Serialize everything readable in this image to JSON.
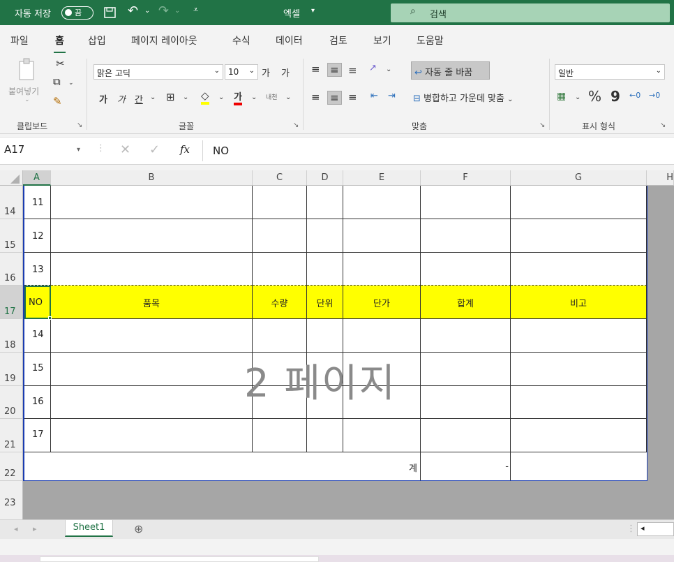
{
  "titlebar": {
    "autosave_label": "자동 저장",
    "autosave_state": "끔",
    "app_title": "엑셀",
    "search_placeholder": "검색"
  },
  "menu": {
    "tabs": [
      {
        "label": "파일"
      },
      {
        "label": "홈",
        "active": true
      },
      {
        "label": "삽입"
      },
      {
        "label": "페이지 레이아웃"
      },
      {
        "label": "수식"
      },
      {
        "label": "데이터"
      },
      {
        "label": "검토"
      },
      {
        "label": "보기"
      },
      {
        "label": "도움말"
      }
    ]
  },
  "ribbon": {
    "clipboard": {
      "paste_label": "붙여넣기",
      "group_label": "클립보드"
    },
    "font": {
      "font_name": "맑은 고딕",
      "font_size": "10",
      "grow": "가",
      "shrink": "가",
      "bold": "가",
      "italic": "가",
      "underline": "간",
      "font_color_glyph": "가",
      "phonetic": "내천",
      "group_label": "글꼴"
    },
    "alignment": {
      "wrap_text": "자동 줄 바꿈",
      "merge_center": "병합하고 가운데 맞춤",
      "group_label": "맞춤"
    },
    "number": {
      "format": "일반",
      "percent": "%",
      "comma": "9",
      "group_label": "표시 형식"
    }
  },
  "formula_bar": {
    "name_box": "A17",
    "fx": "fx",
    "formula": "NO"
  },
  "columns": [
    "A",
    "B",
    "C",
    "D",
    "E",
    "F",
    "G",
    "H"
  ],
  "rows": [
    {
      "num": "14",
      "a": "11"
    },
    {
      "num": "15",
      "a": "12"
    },
    {
      "num": "16",
      "a": "13"
    },
    {
      "num": "17",
      "header": true,
      "a": "NO",
      "b": "품목",
      "c": "수량",
      "d": "단위",
      "e": "단가",
      "f": "합계",
      "g": "비고"
    },
    {
      "num": "18",
      "a": "14"
    },
    {
      "num": "19",
      "a": "15"
    },
    {
      "num": "20",
      "a": "16"
    },
    {
      "num": "21",
      "a": "17"
    },
    {
      "num": "22",
      "total_label": "계",
      "total_value": "-"
    },
    {
      "num": "23"
    }
  ],
  "watermark": "2 페이지",
  "sheets": [
    {
      "name": "Sheet1",
      "active": true
    }
  ],
  "colors": {
    "excel_green": "#217346",
    "header_fill": "#ffff00"
  }
}
